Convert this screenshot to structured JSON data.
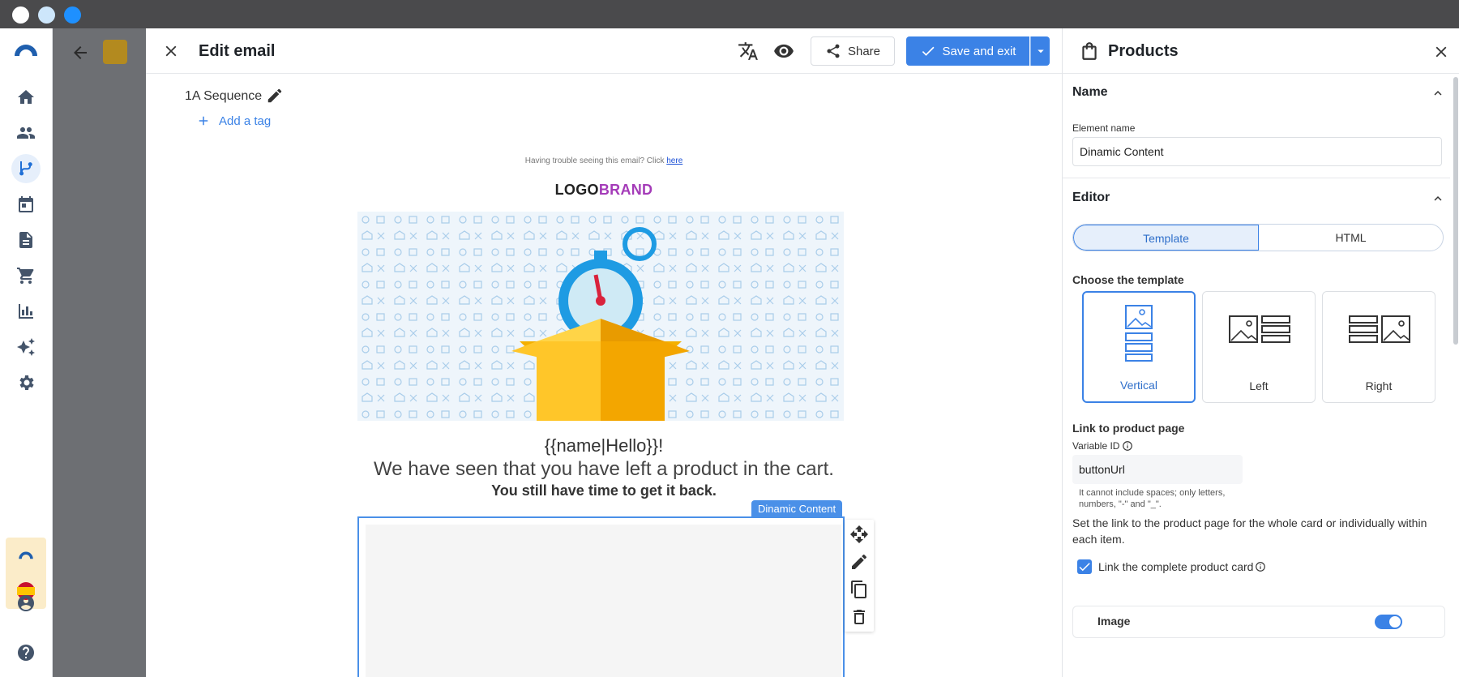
{
  "editor": {
    "title": "Edit email",
    "share_label": "Share",
    "save_label": "Save and exit",
    "sequence_name": "1A Sequence",
    "add_tag_label": "Add a tag"
  },
  "email": {
    "trouble_text": "Having trouble seeing this email? Click",
    "trouble_link": "here",
    "logo_part1": "LOGO",
    "logo_part2": "BRAND",
    "greeting": "{{name|Hello}}!",
    "message_line1": "We have seen that you have left a product in the cart.",
    "message_line2": "You still have time to get it back.",
    "dynamic_block_label": "Dinamic Content"
  },
  "panel": {
    "title": "Products",
    "name_section": "Name",
    "element_name_label": "Element name",
    "element_name_value": "Dinamic Content",
    "editor_section": "Editor",
    "editor_tabs": [
      "Template",
      "HTML"
    ],
    "choose_template_label": "Choose the template",
    "templates": [
      "Vertical",
      "Left",
      "Right"
    ],
    "link_section": "Link to product page",
    "variable_id_label": "Variable ID",
    "variable_id_value": "buttonUrl",
    "variable_hint": "It cannot include spaces; only letters, numbers, \"-\" and \"_\".",
    "link_description": "Set the link to the product page for the whole card or individually within each item.",
    "link_card_label": "Link the complete product card",
    "next_item_label": "Image"
  },
  "colors": {
    "accent": "#3b82e6",
    "brand_purple": "#a43bb8",
    "dynamic_border": "#4a90e8"
  }
}
